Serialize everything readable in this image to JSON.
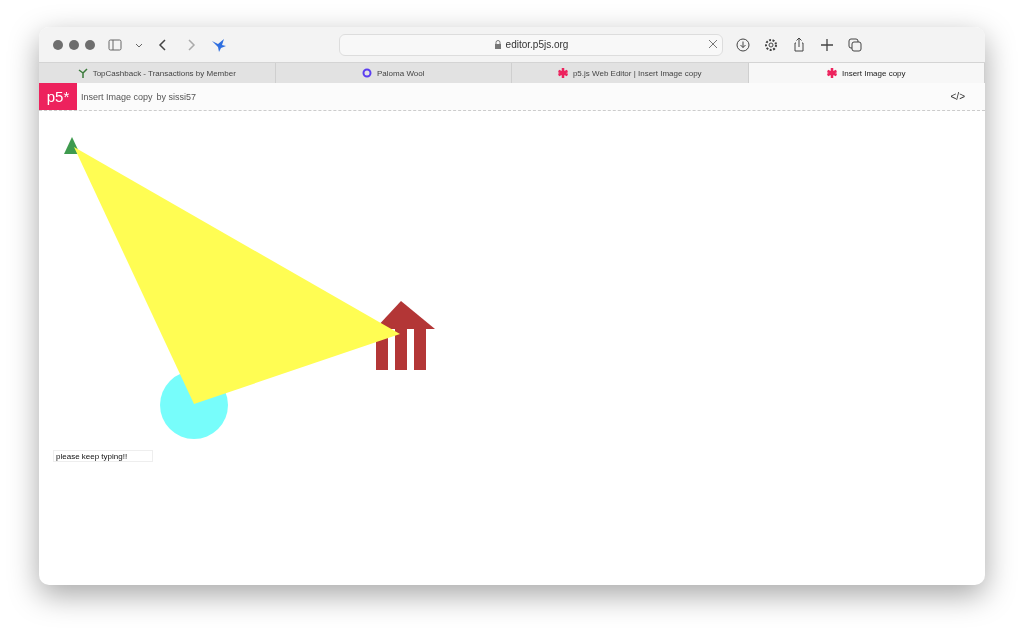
{
  "toolbar": {
    "url": "editor.p5js.org"
  },
  "tabs": [
    {
      "label": "TopCashback - Transactions by Member",
      "kind": "sprout",
      "selected": false
    },
    {
      "label": "Paloma Wool",
      "kind": "ring",
      "selected": false
    },
    {
      "label": "p5.js Web Editor | Insert Image copy",
      "kind": "asterisk",
      "selected": false
    },
    {
      "label": "Insert Image copy",
      "kind": "asterisk",
      "selected": true
    }
  ],
  "header": {
    "logo": "p5*",
    "title": "Insert Image copy",
    "byline": "by sissi57",
    "code_toggle": "</>"
  },
  "sketch": {
    "text_input": {
      "value": "please keep typing!!"
    }
  }
}
